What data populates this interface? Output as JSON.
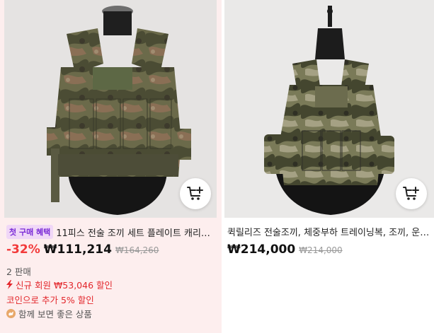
{
  "products": [
    {
      "badge": "첫 구매 혜택",
      "title": "11피스 전술 조끼 세트 플레이트 캐리…",
      "discount": "-32%",
      "price": "₩111,214",
      "original_price": "₩164,260",
      "sold": "2 판매",
      "member_discount": "신규 회원 ₩53,046 할인",
      "coin_discount": "코인으로 추가 5% 할인",
      "together_label": "함께 보면 좋은 상품"
    },
    {
      "title": "퀵릴리즈 전술조끼, 체중부하 트레이닝복, 조끼, 운…",
      "price": "₩214,000",
      "original_price": "₩214,000"
    }
  ],
  "icons": {
    "cart": "add-to-cart-icon",
    "bolt": "lightning-icon",
    "together": "recommend-icon"
  },
  "colors": {
    "sale_red": "#e3262b",
    "badge_bg": "#f0d7f7",
    "badge_text": "#7a2ad6",
    "left_card_bg": "#fdeeee"
  }
}
